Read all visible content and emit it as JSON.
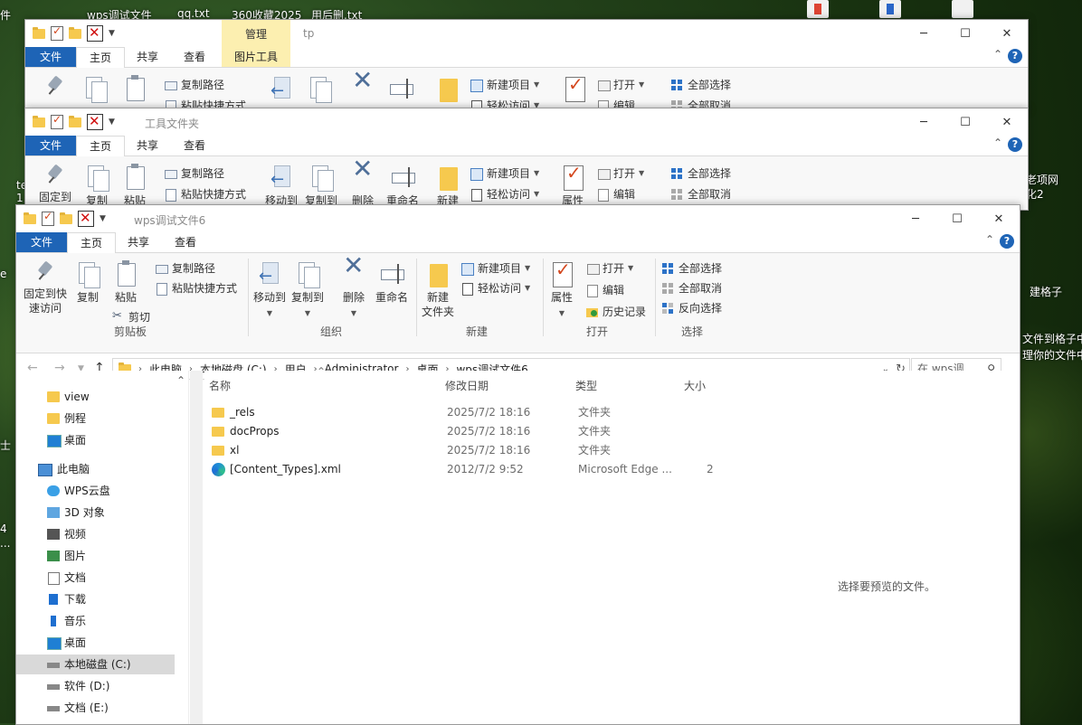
{
  "desktop": {
    "top_labels": [
      "wps调试文件",
      "qq.txt",
      "360收藏2025",
      "用后删.txt"
    ],
    "left_labels": [
      "件",
      "te",
      "1",
      "e",
      "士",
      "4",
      "..."
    ],
    "right_labels": [
      "老项网",
      "化2",
      "建格子",
      "文件到格子中",
      "理你的文件中"
    ]
  },
  "win1": {
    "title": "tp",
    "manage_tab": "管理",
    "tabs": [
      "文件",
      "主页",
      "共享",
      "查看",
      "图片工具"
    ],
    "ribbon": {
      "copy_path": "复制路径",
      "paste_shortcut": "粘贴快捷方式",
      "new_item": "新建项目",
      "easy_access": "轻松访问",
      "open": "打开",
      "edit": "编辑",
      "select_all": "全部选择",
      "select_none": "全部取消"
    }
  },
  "win2": {
    "title": "工具文件夹",
    "tabs": [
      "文件",
      "主页",
      "共享",
      "查看"
    ],
    "ribbon": {
      "copy_path": "复制路径",
      "paste_shortcut": "粘贴快捷方式",
      "new_item": "新建项目",
      "easy_access": "轻松访问",
      "open": "打开",
      "edit": "编辑",
      "select_all": "全部选择",
      "select_none": "全部取消",
      "pin": "固定到快",
      "copy": "复制",
      "paste": "粘贴",
      "move_to": "移动到",
      "copy_to": "复制到",
      "delete": "删除",
      "rename": "重命名",
      "new": "新建",
      "props": "属性"
    }
  },
  "win3": {
    "title": "wps调试文件6",
    "tabs": [
      "文件",
      "主页",
      "共享",
      "查看"
    ],
    "ribbon": {
      "pin_line1": "固定到快",
      "pin_line2": "速访问",
      "copy": "复制",
      "paste": "粘贴",
      "copy_path": "复制路径",
      "paste_shortcut": "粘贴快捷方式",
      "cut": "剪切",
      "move_to": "移动到",
      "copy_to": "复制到",
      "delete": "删除",
      "rename": "重命名",
      "new_folder_line1": "新建",
      "new_folder_line2": "文件夹",
      "new_item": "新建项目",
      "easy_access": "轻松访问",
      "props": "属性",
      "open": "打开",
      "edit": "编辑",
      "history": "历史记录",
      "select_all": "全部选择",
      "select_none": "全部取消",
      "invert": "反向选择",
      "groups": [
        "剪贴板",
        "组织",
        "新建",
        "打开",
        "选择"
      ]
    },
    "address": {
      "crumbs": [
        "此电脑",
        "本地磁盘 (C:)",
        "用户",
        "Administrator",
        "桌面",
        "wps调试文件6"
      ],
      "search_placeholder": "在 wps调..."
    },
    "nav": [
      {
        "label": "view",
        "icon": "folder"
      },
      {
        "label": "例程",
        "icon": "folder"
      },
      {
        "label": "桌面",
        "icon": "desk"
      },
      {
        "label": "此电脑",
        "icon": "pc"
      },
      {
        "label": "WPS云盘",
        "icon": "cloud"
      },
      {
        "label": "3D 对象",
        "icon": "cube"
      },
      {
        "label": "视频",
        "icon": "video"
      },
      {
        "label": "图片",
        "icon": "pic"
      },
      {
        "label": "文档",
        "icon": "doc"
      },
      {
        "label": "下载",
        "icon": "down"
      },
      {
        "label": "音乐",
        "icon": "music"
      },
      {
        "label": "桌面",
        "icon": "desk"
      },
      {
        "label": "本地磁盘 (C:)",
        "icon": "disk"
      },
      {
        "label": "软件 (D:)",
        "icon": "disk"
      },
      {
        "label": "文档 (E:)",
        "icon": "disk"
      }
    ],
    "columns": [
      "名称",
      "修改日期",
      "类型",
      "大小"
    ],
    "files": [
      {
        "name": "_rels",
        "date": "2025/7/2 18:16",
        "type": "文件夹",
        "size": "",
        "icon": "folder"
      },
      {
        "name": "docProps",
        "date": "2025/7/2 18:16",
        "type": "文件夹",
        "size": "",
        "icon": "folder"
      },
      {
        "name": "xl",
        "date": "2025/7/2 18:16",
        "type": "文件夹",
        "size": "",
        "icon": "folder"
      },
      {
        "name": "[Content_Types].xml",
        "date": "2012/7/2 9:52",
        "type": "Microsoft Edge ...",
        "size": "2",
        "icon": "edge"
      }
    ],
    "preview_text": "选择要预览的文件。"
  }
}
